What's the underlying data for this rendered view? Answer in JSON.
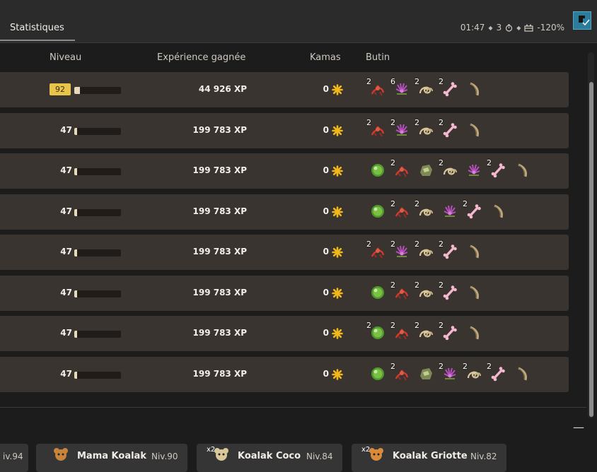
{
  "header": {
    "tab": "Statistiques",
    "time": "01:47",
    "turns": "3",
    "percent": "-120%"
  },
  "columns": {
    "level": "Niveau",
    "xp": "Expérience gagnée",
    "kamas": "Kamas",
    "loot": "Butin"
  },
  "rows": [
    {
      "level": "92",
      "xp": "44 926 XP",
      "kamas": "0",
      "bar_fraction": 0.12,
      "badge": true,
      "loot": [
        {
          "icon": "red-plant-icon",
          "qty": "2"
        },
        {
          "icon": "purple-flower-icon",
          "qty": "6"
        },
        {
          "icon": "shell-icon",
          "qty": "2"
        },
        {
          "icon": "bone-icon",
          "qty": "2"
        },
        {
          "icon": "horn-icon",
          "qty": ""
        }
      ]
    },
    {
      "level": "47",
      "xp": "199 783 XP",
      "kamas": "0",
      "bar_fraction": 0.06,
      "loot": [
        {
          "icon": "red-plant-icon",
          "qty": "2"
        },
        {
          "icon": "purple-flower-icon",
          "qty": "2"
        },
        {
          "icon": "shell-icon",
          "qty": "2"
        },
        {
          "icon": "bone-icon",
          "qty": "2"
        },
        {
          "icon": "horn-icon",
          "qty": ""
        }
      ]
    },
    {
      "level": "47",
      "xp": "199 783 XP",
      "kamas": "0",
      "bar_fraction": 0.06,
      "loot": [
        {
          "icon": "green-orb-icon",
          "qty": ""
        },
        {
          "icon": "red-plant-icon",
          "qty": "2"
        },
        {
          "icon": "stone-icon",
          "qty": ""
        },
        {
          "icon": "shell-icon",
          "qty": "2"
        },
        {
          "icon": "purple-flower-icon",
          "qty": ""
        },
        {
          "icon": "bone-icon",
          "qty": "2"
        },
        {
          "icon": "horn-icon",
          "qty": ""
        }
      ]
    },
    {
      "level": "47",
      "xp": "199 783 XP",
      "kamas": "0",
      "bar_fraction": 0.06,
      "loot": [
        {
          "icon": "green-orb-icon",
          "qty": ""
        },
        {
          "icon": "red-plant-icon",
          "qty": "2"
        },
        {
          "icon": "shell-icon",
          "qty": "2"
        },
        {
          "icon": "purple-flower-icon",
          "qty": ""
        },
        {
          "icon": "bone-icon",
          "qty": "2"
        },
        {
          "icon": "horn-icon",
          "qty": ""
        }
      ]
    },
    {
      "level": "47",
      "xp": "199 783 XP",
      "kamas": "0",
      "bar_fraction": 0.06,
      "loot": [
        {
          "icon": "red-plant-icon",
          "qty": "2"
        },
        {
          "icon": "purple-flower-icon",
          "qty": "2"
        },
        {
          "icon": "shell-icon",
          "qty": "2"
        },
        {
          "icon": "bone-icon",
          "qty": "2"
        },
        {
          "icon": "horn-icon",
          "qty": ""
        }
      ]
    },
    {
      "level": "47",
      "xp": "199 783 XP",
      "kamas": "0",
      "bar_fraction": 0.06,
      "loot": [
        {
          "icon": "green-orb-icon",
          "qty": ""
        },
        {
          "icon": "red-plant-icon",
          "qty": "2"
        },
        {
          "icon": "shell-icon",
          "qty": "2"
        },
        {
          "icon": "bone-icon",
          "qty": "2"
        },
        {
          "icon": "horn-icon",
          "qty": ""
        }
      ]
    },
    {
      "level": "47",
      "xp": "199 783 XP",
      "kamas": "0",
      "bar_fraction": 0.06,
      "loot": [
        {
          "icon": "green-orb-icon",
          "qty": "2"
        },
        {
          "icon": "red-plant-icon",
          "qty": "2"
        },
        {
          "icon": "shell-icon",
          "qty": "2"
        },
        {
          "icon": "bone-icon",
          "qty": "2"
        },
        {
          "icon": "horn-icon",
          "qty": ""
        }
      ]
    },
    {
      "level": "47",
      "xp": "199 783 XP",
      "kamas": "0",
      "bar_fraction": 0.06,
      "loot": [
        {
          "icon": "green-orb-icon",
          "qty": ""
        },
        {
          "icon": "red-plant-icon",
          "qty": "2"
        },
        {
          "icon": "stone-icon",
          "qty": ""
        },
        {
          "icon": "purple-flower-icon",
          "qty": "2"
        },
        {
          "icon": "shell-icon",
          "qty": "2"
        },
        {
          "icon": "bone-icon",
          "qty": "2"
        },
        {
          "icon": "horn-icon",
          "qty": ""
        }
      ]
    }
  ],
  "monsters": [
    {
      "name": "",
      "level": "iv.94",
      "mult": ""
    },
    {
      "name": "Mama Koalak",
      "level": "Niv.90",
      "mult": ""
    },
    {
      "name": "Koalak Coco",
      "level": "Niv.84",
      "mult": "x2"
    },
    {
      "name": "Koalak Griotte",
      "level": "Niv.82",
      "mult": "x2"
    }
  ],
  "colors": {
    "accent": "#e9c44a",
    "row": "#39342f",
    "kamas": "#f1b81c"
  }
}
